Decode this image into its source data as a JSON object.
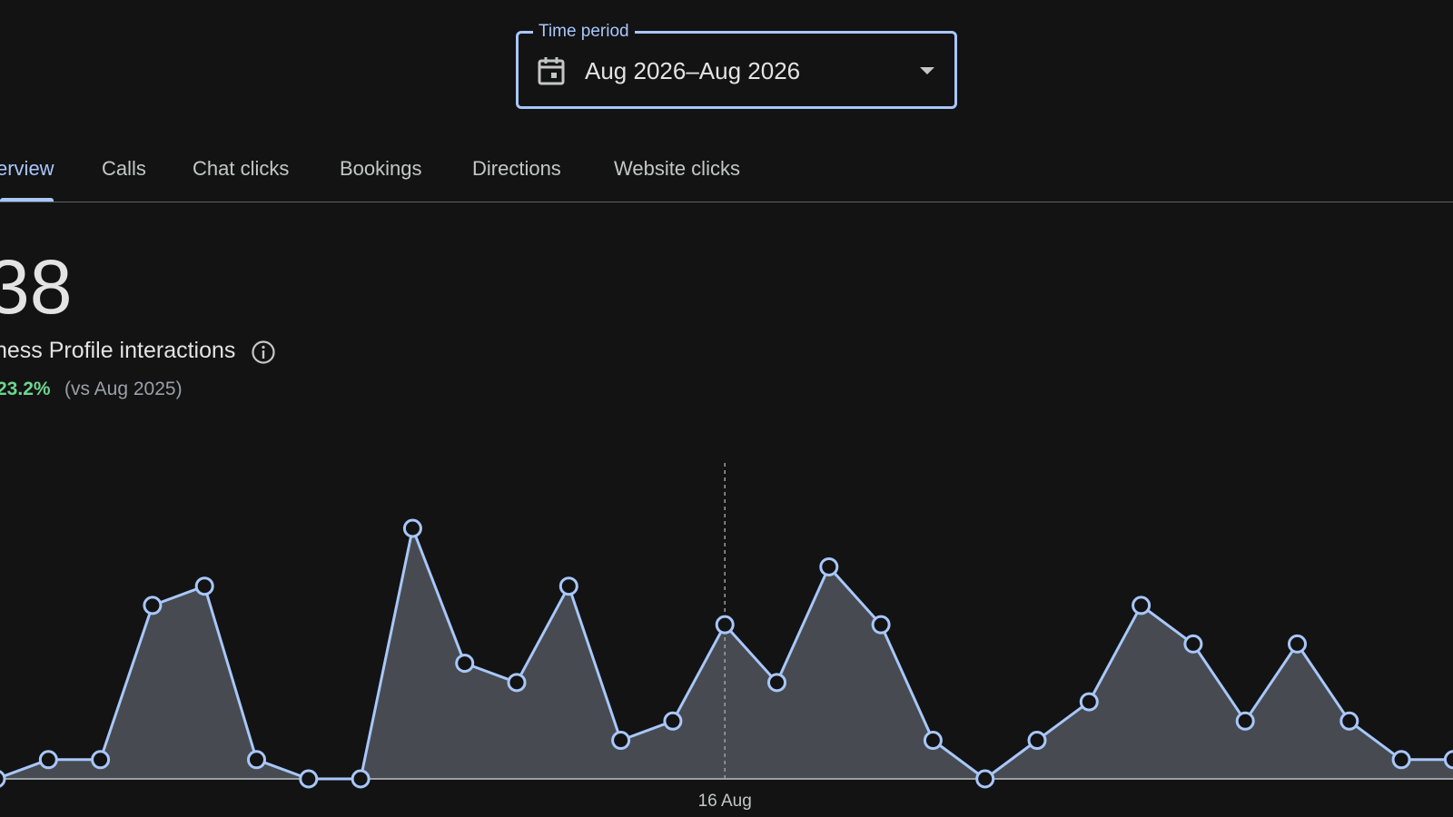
{
  "time_period": {
    "label": "Time period",
    "value": "Aug 2026–Aug 2026",
    "icon": "calendar-icon"
  },
  "tabs": [
    {
      "label": "erview",
      "active": true
    },
    {
      "label": "Calls",
      "active": false
    },
    {
      "label": "Chat clicks",
      "active": false
    },
    {
      "label": "Bookings",
      "active": false
    },
    {
      "label": "Directions",
      "active": false
    },
    {
      "label": "Website clicks",
      "active": false
    }
  ],
  "summary": {
    "total": "38",
    "label": "ness Profile interactions",
    "change": "23.2%",
    "comparison": "(vs Aug 2025)",
    "change_color": "#6dd58c"
  },
  "colors": {
    "accent": "#a8c7fa",
    "background": "#131314",
    "area_fill": "#474b51"
  },
  "chart_data": {
    "type": "area",
    "series": [
      {
        "values": [
          0,
          1,
          1,
          9,
          10,
          1,
          0,
          0,
          13,
          6,
          5,
          10,
          2,
          3,
          8,
          5,
          11,
          8,
          2,
          0,
          2,
          4,
          9,
          7,
          3,
          7,
          3,
          1,
          1
        ]
      }
    ],
    "x_tick_labels": [
      "16 Aug"
    ],
    "ylim": [
      0,
      13
    ],
    "grid": false
  }
}
